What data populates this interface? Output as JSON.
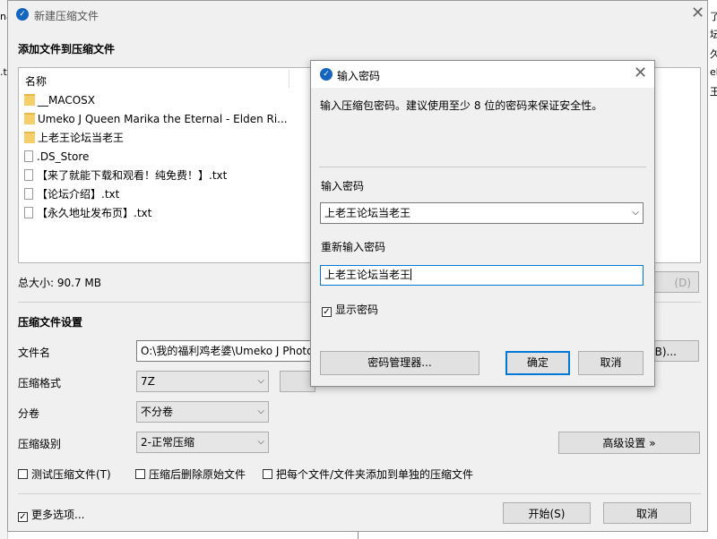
{
  "main_dialog": {
    "title": "新建压缩文件",
    "add_files_heading": "添加文件到压缩文件",
    "column_name": "名称",
    "files": [
      {
        "name": "__MACOSX",
        "icon": "folder-icon"
      },
      {
        "name": "Umeko J Queen Marika the Eternal - Elden Ri...",
        "icon": "folder-icon"
      },
      {
        "name": "上老王论坛当老王",
        "icon": "folder-icon"
      },
      {
        "name": ".DS_Store",
        "icon": "file-icon"
      },
      {
        "name": "【来了就能下载和观看！纯免费！】.txt",
        "icon": "file-icon"
      },
      {
        "name": "【论坛介绍】.txt",
        "icon": "file-icon"
      },
      {
        "name": "【永久地址发布页】.txt",
        "icon": "file-icon"
      }
    ],
    "total_size": "总大小: 90.7 MB",
    "delete_button_partial": "(D)",
    "settings_heading": "压缩文件设置",
    "filename_label": "文件名",
    "filename_value": "O:\\我的福利鸡老婆\\Umeko J Photo",
    "browse_button_partial": "(B)...",
    "format_label": "压缩格式",
    "format_value": "7Z",
    "volume_label": "分卷",
    "volume_value": "不分卷",
    "level_label": "压缩级别",
    "level_value": "2-正常压缩",
    "advanced_button": "高级设置 »",
    "test_checkbox": "测试压缩文件(T)",
    "delete_original_checkbox": "压缩后删除原始文件",
    "separate_checkbox": "把每个文件/文件夹添加到单独的压缩文件",
    "more_options_checkbox": "更多选项...",
    "start_button": "开始(S)",
    "cancel_button": "取消"
  },
  "password_dialog": {
    "title": "输入密码",
    "instruction": "输入压缩包密码。建议使用至少 8 位的密码来保证安全性。",
    "password_label": "输入密码",
    "password_value": "上老王论坛当老王",
    "reenter_label": "重新输入密码",
    "reenter_value": "上老王论坛当老王",
    "show_password_label": "显示密码",
    "show_password_checked": true,
    "manager_button": "密码管理器...",
    "ok_button": "确定",
    "cancel_button": "取消"
  },
  "background_fragments": {
    "left_top": "na",
    "left_mid": ".t",
    "right": [
      "了",
      "坛",
      "久",
      "ek",
      "王"
    ]
  },
  "colors": {
    "accent": "#0078d7",
    "title_icon": "#1565c0",
    "dialog_bg": "#f0f0f0",
    "folder": "#f5cf6a"
  }
}
